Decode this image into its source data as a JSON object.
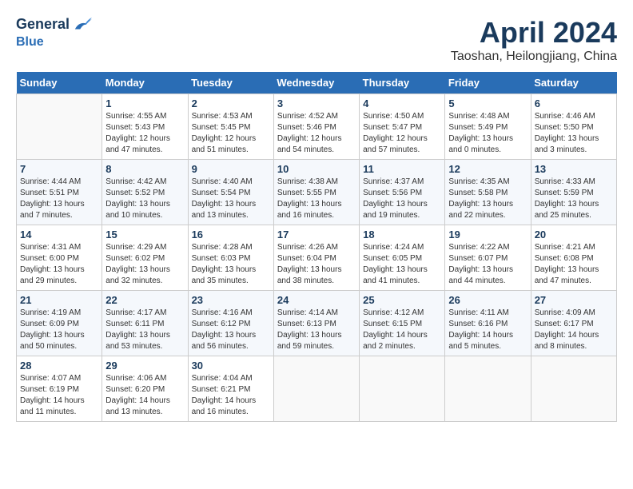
{
  "header": {
    "logo_line1": "General",
    "logo_line2": "Blue",
    "main_title": "April 2024",
    "subtitle": "Taoshan, Heilongjiang, China"
  },
  "weekdays": [
    "Sunday",
    "Monday",
    "Tuesday",
    "Wednesday",
    "Thursday",
    "Friday",
    "Saturday"
  ],
  "weeks": [
    [
      {
        "day": "",
        "info": ""
      },
      {
        "day": "1",
        "info": "Sunrise: 4:55 AM\nSunset: 5:43 PM\nDaylight: 12 hours\nand 47 minutes."
      },
      {
        "day": "2",
        "info": "Sunrise: 4:53 AM\nSunset: 5:45 PM\nDaylight: 12 hours\nand 51 minutes."
      },
      {
        "day": "3",
        "info": "Sunrise: 4:52 AM\nSunset: 5:46 PM\nDaylight: 12 hours\nand 54 minutes."
      },
      {
        "day": "4",
        "info": "Sunrise: 4:50 AM\nSunset: 5:47 PM\nDaylight: 12 hours\nand 57 minutes."
      },
      {
        "day": "5",
        "info": "Sunrise: 4:48 AM\nSunset: 5:49 PM\nDaylight: 13 hours\nand 0 minutes."
      },
      {
        "day": "6",
        "info": "Sunrise: 4:46 AM\nSunset: 5:50 PM\nDaylight: 13 hours\nand 3 minutes."
      }
    ],
    [
      {
        "day": "7",
        "info": "Sunrise: 4:44 AM\nSunset: 5:51 PM\nDaylight: 13 hours\nand 7 minutes."
      },
      {
        "day": "8",
        "info": "Sunrise: 4:42 AM\nSunset: 5:52 PM\nDaylight: 13 hours\nand 10 minutes."
      },
      {
        "day": "9",
        "info": "Sunrise: 4:40 AM\nSunset: 5:54 PM\nDaylight: 13 hours\nand 13 minutes."
      },
      {
        "day": "10",
        "info": "Sunrise: 4:38 AM\nSunset: 5:55 PM\nDaylight: 13 hours\nand 16 minutes."
      },
      {
        "day": "11",
        "info": "Sunrise: 4:37 AM\nSunset: 5:56 PM\nDaylight: 13 hours\nand 19 minutes."
      },
      {
        "day": "12",
        "info": "Sunrise: 4:35 AM\nSunset: 5:58 PM\nDaylight: 13 hours\nand 22 minutes."
      },
      {
        "day": "13",
        "info": "Sunrise: 4:33 AM\nSunset: 5:59 PM\nDaylight: 13 hours\nand 25 minutes."
      }
    ],
    [
      {
        "day": "14",
        "info": "Sunrise: 4:31 AM\nSunset: 6:00 PM\nDaylight: 13 hours\nand 29 minutes."
      },
      {
        "day": "15",
        "info": "Sunrise: 4:29 AM\nSunset: 6:02 PM\nDaylight: 13 hours\nand 32 minutes."
      },
      {
        "day": "16",
        "info": "Sunrise: 4:28 AM\nSunset: 6:03 PM\nDaylight: 13 hours\nand 35 minutes."
      },
      {
        "day": "17",
        "info": "Sunrise: 4:26 AM\nSunset: 6:04 PM\nDaylight: 13 hours\nand 38 minutes."
      },
      {
        "day": "18",
        "info": "Sunrise: 4:24 AM\nSunset: 6:05 PM\nDaylight: 13 hours\nand 41 minutes."
      },
      {
        "day": "19",
        "info": "Sunrise: 4:22 AM\nSunset: 6:07 PM\nDaylight: 13 hours\nand 44 minutes."
      },
      {
        "day": "20",
        "info": "Sunrise: 4:21 AM\nSunset: 6:08 PM\nDaylight: 13 hours\nand 47 minutes."
      }
    ],
    [
      {
        "day": "21",
        "info": "Sunrise: 4:19 AM\nSunset: 6:09 PM\nDaylight: 13 hours\nand 50 minutes."
      },
      {
        "day": "22",
        "info": "Sunrise: 4:17 AM\nSunset: 6:11 PM\nDaylight: 13 hours\nand 53 minutes."
      },
      {
        "day": "23",
        "info": "Sunrise: 4:16 AM\nSunset: 6:12 PM\nDaylight: 13 hours\nand 56 minutes."
      },
      {
        "day": "24",
        "info": "Sunrise: 4:14 AM\nSunset: 6:13 PM\nDaylight: 13 hours\nand 59 minutes."
      },
      {
        "day": "25",
        "info": "Sunrise: 4:12 AM\nSunset: 6:15 PM\nDaylight: 14 hours\nand 2 minutes."
      },
      {
        "day": "26",
        "info": "Sunrise: 4:11 AM\nSunset: 6:16 PM\nDaylight: 14 hours\nand 5 minutes."
      },
      {
        "day": "27",
        "info": "Sunrise: 4:09 AM\nSunset: 6:17 PM\nDaylight: 14 hours\nand 8 minutes."
      }
    ],
    [
      {
        "day": "28",
        "info": "Sunrise: 4:07 AM\nSunset: 6:19 PM\nDaylight: 14 hours\nand 11 minutes."
      },
      {
        "day": "29",
        "info": "Sunrise: 4:06 AM\nSunset: 6:20 PM\nDaylight: 14 hours\nand 13 minutes."
      },
      {
        "day": "30",
        "info": "Sunrise: 4:04 AM\nSunset: 6:21 PM\nDaylight: 14 hours\nand 16 minutes."
      },
      {
        "day": "",
        "info": ""
      },
      {
        "day": "",
        "info": ""
      },
      {
        "day": "",
        "info": ""
      },
      {
        "day": "",
        "info": ""
      }
    ]
  ]
}
